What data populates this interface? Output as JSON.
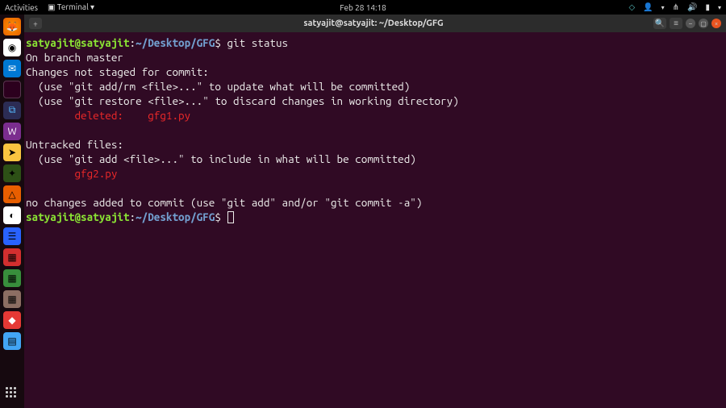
{
  "top_panel": {
    "activities": "Activities",
    "app_menu": "Terminal ▾",
    "clock": "Feb 28  14:18"
  },
  "dock": {
    "items": [
      "firefox",
      "chrome",
      "outlook",
      "terminal",
      "vscode",
      "word",
      "files",
      "settings",
      "vlc",
      "excel",
      "app1",
      "app2",
      "app3",
      "app4",
      "app5",
      "app6"
    ]
  },
  "window": {
    "title": "satyajit@satyajit: ~/Desktop/GFG",
    "new_tab": "+"
  },
  "prompt": {
    "user_host": "satyajit@satyajit",
    "colon": ":",
    "path": "~/Desktop/GFG",
    "dollar": "$"
  },
  "terminal": {
    "cmd1": "git status",
    "l1": "On branch master",
    "l2": "Changes not staged for commit:",
    "l3": "  (use \"git add/rm <file>...\" to update what will be committed)",
    "l4": "  (use \"git restore <file>...\" to discard changes in working directory)",
    "l5": "        deleted:    gfg1.py",
    "l6": "Untracked files:",
    "l7": "  (use \"git add <file>...\" to include in what will be committed)",
    "l8": "        gfg2.py",
    "l9": "no changes added to commit (use \"git add\" and/or \"git commit -a\")"
  }
}
